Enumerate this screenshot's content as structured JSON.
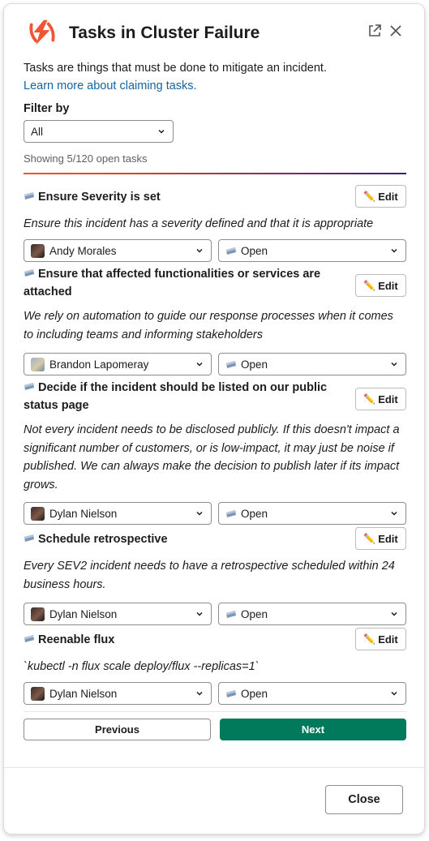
{
  "header": {
    "title": "Tasks in Cluster Failure",
    "logo_icon": "incident-io-logo",
    "brand_color": "#f25533"
  },
  "intro": {
    "text": "Tasks are things that must be done to mitigate an incident.",
    "link_text": "Learn more about claiming tasks."
  },
  "filter": {
    "label": "Filter by",
    "selected": "All"
  },
  "showing_text": "Showing 5/120 open tasks",
  "tasks": [
    {
      "title": "Ensure Severity is set",
      "edit_label": "Edit",
      "description": "Ensure this incident has a severity defined and that it is appropriate",
      "assignee": "Andy Morales",
      "status": "Open"
    },
    {
      "title": "Ensure that affected functionalities or services are attached",
      "edit_label": "Edit",
      "description": "We rely on automation to guide our response processes when it comes to including teams and informing stakeholders",
      "assignee": "Brandon Lapomeray",
      "status": "Open"
    },
    {
      "title": "Decide if the incident should be listed on our public status page",
      "edit_label": "Edit",
      "description": "Not every incident needs to be disclosed publicly. If this doesn't impact a significant number of customers, or is low-impact, it may just be noise if published. We can always make the decision to publish later if its impact grows.",
      "assignee": "Dylan Nielson",
      "status": "Open"
    },
    {
      "title": "Schedule retrospective",
      "edit_label": "Edit",
      "description": "Every SEV2 incident needs to have a retrospective scheduled within 24 business hours.",
      "assignee": "Dylan Nielson",
      "status": "Open"
    },
    {
      "title": "Reenable flux",
      "edit_label": "Edit",
      "description": "`kubectl -n flux scale deploy/flux --replicas=1`",
      "assignee": "Dylan Nielson",
      "status": "Open"
    }
  ],
  "pagination": {
    "previous_label": "Previous",
    "next_label": "Next",
    "next_color": "#007a5a"
  },
  "footer": {
    "close_label": "Close"
  },
  "colors": {
    "link": "#1264a3",
    "accent_gradient_start": "#f25533",
    "accent_gradient_end": "#36207a"
  }
}
